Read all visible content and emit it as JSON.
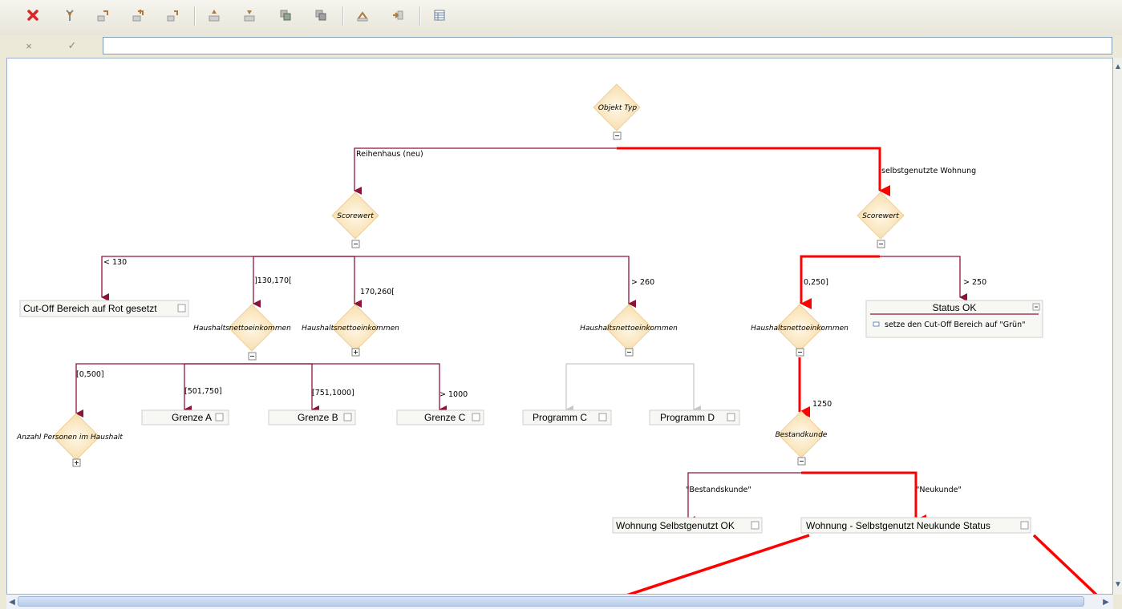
{
  "toolbar": {
    "buttons": [
      "delete-icon",
      "rule-icon",
      "insert-node-icon",
      "insert-subtree-icon",
      "insert-child-icon",
      "move-up-icon",
      "move-down-icon",
      "copy-icon",
      "paste-icon",
      "collapse-icon",
      "expand-icon",
      "table-view-icon"
    ]
  },
  "editbar": {
    "cancel_label": "×",
    "confirm_label": "✓",
    "formula_value": ""
  },
  "tree": {
    "root": "Objekt Typ",
    "edge_reihenhaus": "Reihenhaus (neu)",
    "edge_selbstgenutzt": "selbstgenutzte Wohnung",
    "scorewert_left": "Scorewert",
    "scorewert_right": "Scorewert",
    "edge_lt130": "< 130",
    "edge_130_170": "]130,170[",
    "edge_170_260": "170,260[",
    "edge_gt260": "> 260",
    "cutoff_box": "Cut-Off Bereich auf Rot gesetzt",
    "hne_1": "Haushaltsnettoeinkommen",
    "hne_2": "Haushaltsnettoeinkommen",
    "hne_3": "Haushaltsnettoeinkommen",
    "edge_0_500": "[0,500]",
    "edge_501_750": "[501,750]",
    "edge_751_1000": "[751,1000]",
    "edge_gt1000": "> 1000",
    "anzahl_personen": "Anzahl Personen im Haushalt",
    "grenze_a": "Grenze A",
    "grenze_b": "Grenze B",
    "grenze_c": "Grenze C",
    "programm_c": "Programm C",
    "programm_d": "Programm D",
    "edge_0_250": "0,250]",
    "edge_gt250": "> 250",
    "hne_right": "Haushaltsnettoeinkommen",
    "status_ok_title": "Status OK",
    "status_ok_action": "setze den Cut-Off Bereich auf \"Grün\"",
    "edge_1250": "1250",
    "bestandkunde": "Bestandkunde",
    "edge_bestandskunde": "\"Bestandskunde\"",
    "edge_neukunde": "\"Neukunde\"",
    "wohnung_ok": "Wohnung Selbstgenutzt OK",
    "wohnung_neukunde": "Wohnung - Selbstgenutzt Neukunde Status"
  },
  "colors": {
    "edge": "#8b1538",
    "highlight": "#ff0000",
    "disabled_edge": "#c8c8c8",
    "diamond_fill": "#fde9c5"
  }
}
